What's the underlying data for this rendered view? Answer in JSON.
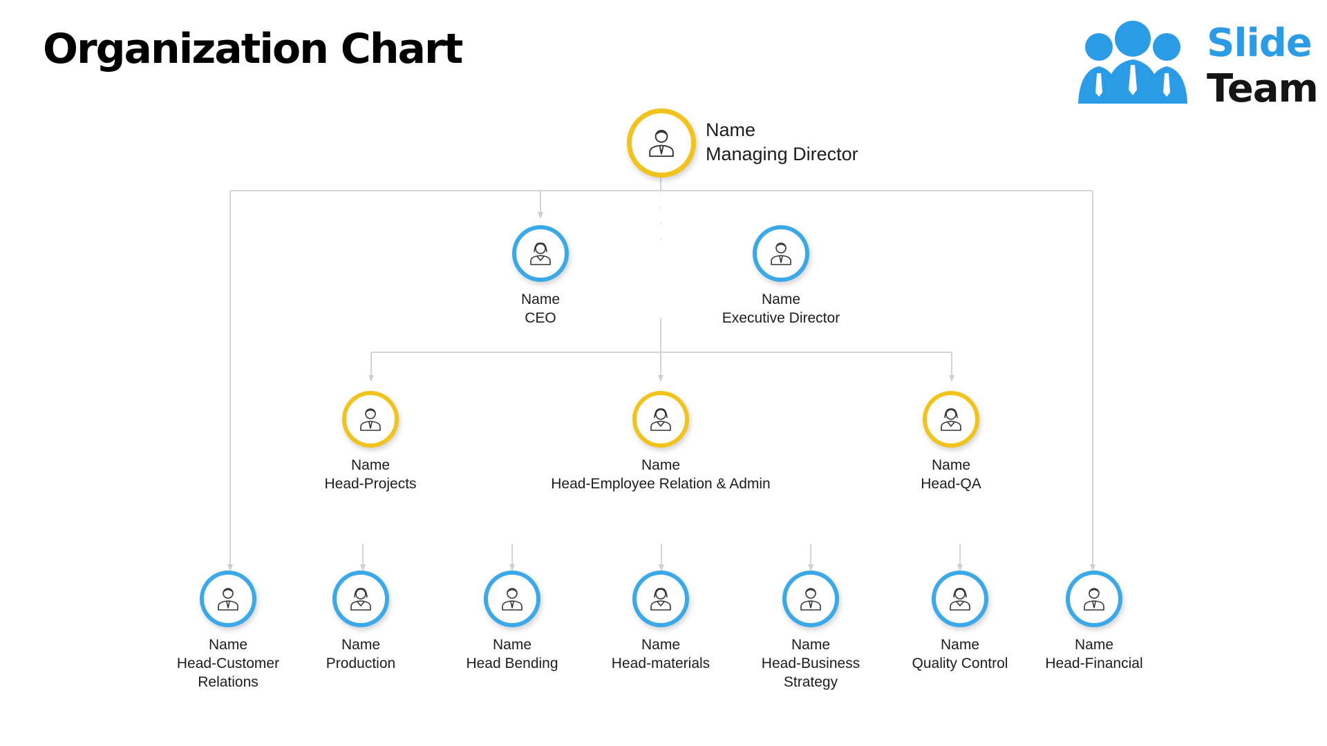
{
  "title": "Organization Chart",
  "logo": {
    "word1": "Slide",
    "word2": "Team",
    "brand_blue": "#2a9be6",
    "dark": "#141414"
  },
  "colors": {
    "blue_ring": "#3aa9ea",
    "gold_ring": "#f2c31a",
    "connector": "#d4d4d4"
  },
  "nodes": {
    "managing_director": {
      "name": "Name",
      "role": "Managing Director",
      "ring": "gold"
    },
    "ceo": {
      "name": "Name",
      "role": "CEO",
      "ring": "blue"
    },
    "executive_director": {
      "name": "Name",
      "role": "Executive Director",
      "ring": "blue"
    },
    "head_projects": {
      "name": "Name",
      "role": "Head-Projects",
      "ring": "gold"
    },
    "head_employee_relation": {
      "name": "Name",
      "role": "Head-Employee Relation & Admin",
      "ring": "gold"
    },
    "head_qa": {
      "name": "Name",
      "role": "Head-QA",
      "ring": "gold"
    },
    "head_customer_relations": {
      "name": "Name",
      "role_line1": "Head-Customer",
      "role_line2": "Relations",
      "ring": "blue"
    },
    "production": {
      "name": "Name",
      "role": "Production",
      "ring": "blue"
    },
    "head_bending": {
      "name": "Name",
      "role": "Head Bending",
      "ring": "blue"
    },
    "head_materials": {
      "name": "Name",
      "role": "Head-materials",
      "ring": "blue"
    },
    "head_business_strategy": {
      "name": "Name",
      "role_line1": "Head-Business",
      "role_line2": "Strategy",
      "ring": "blue"
    },
    "quality_control": {
      "name": "Name",
      "role": "Quality Control",
      "ring": "blue"
    },
    "head_financial": {
      "name": "Name",
      "role": "Head-Financial",
      "ring": "blue"
    }
  },
  "icons": {
    "managing_director": "businessman-icon",
    "ceo": "businesswoman-icon",
    "executive_director": "businessman-icon",
    "head_projects": "businessman-icon",
    "head_employee_relation": "businesswoman-icon",
    "head_qa": "businesswoman-icon",
    "head_customer_relations": "businessman-icon",
    "production": "businesswoman-icon",
    "head_bending": "businessman-icon",
    "head_materials": "businesswoman-icon",
    "head_business_strategy": "businessman-icon",
    "quality_control": "businesswoman-icon",
    "head_financial": "businessman-icon"
  }
}
